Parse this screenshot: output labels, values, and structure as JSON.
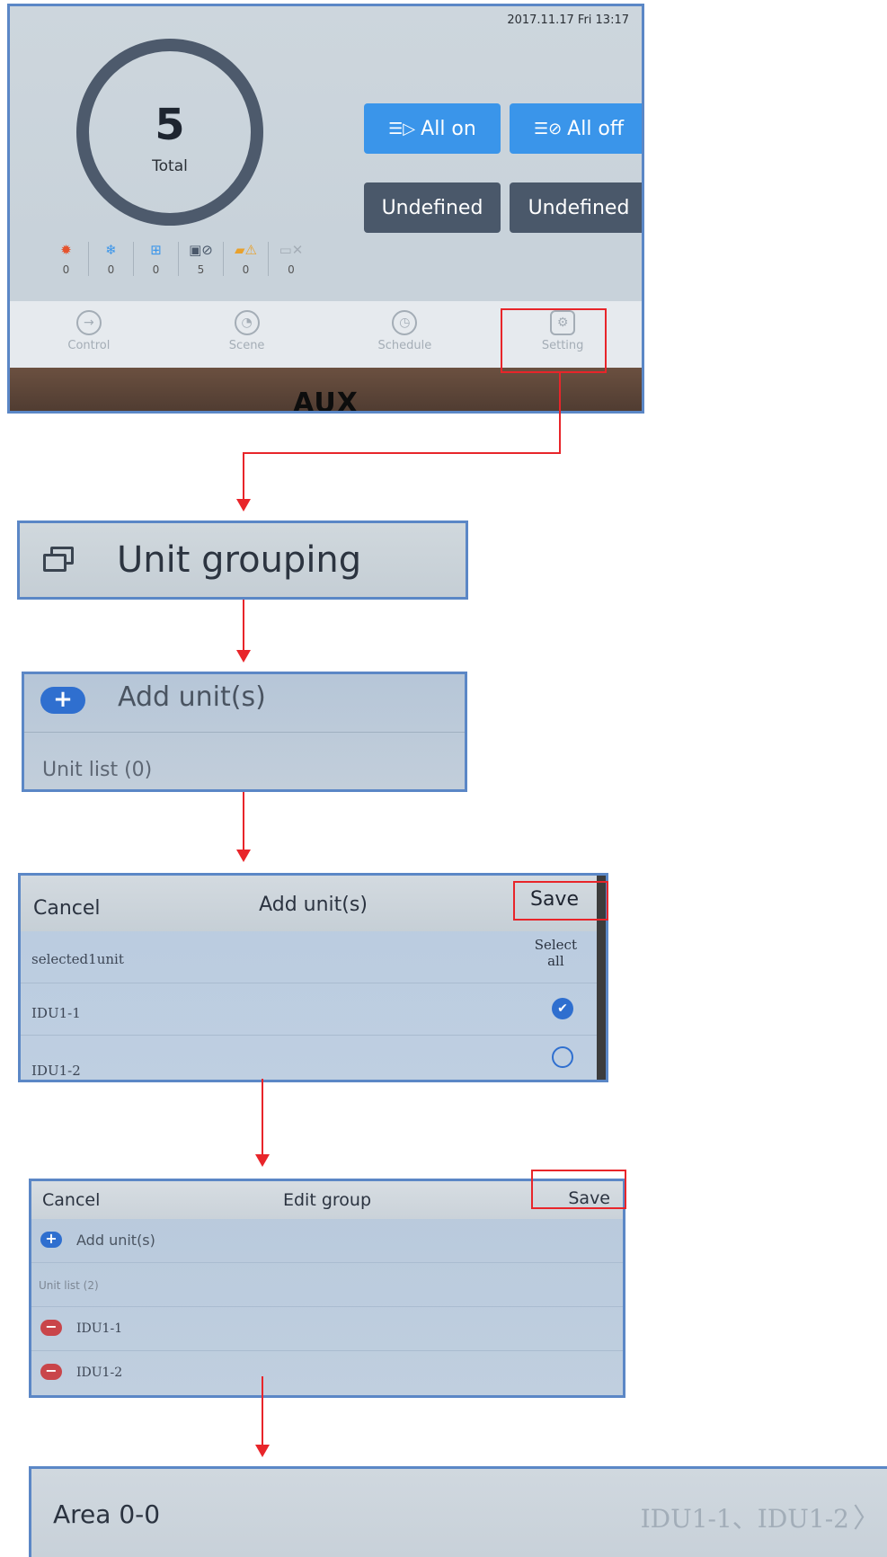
{
  "home": {
    "datetime": "2017.11.17 Fri 13:17",
    "total_count": "5",
    "total_label": "Total",
    "all_on_label": "All on",
    "all_off_label": "All off",
    "undefined_1_label": "Undefined",
    "undefined_2_label": "Undefined",
    "stats": [
      {
        "icon": "heat-icon",
        "value": "0"
      },
      {
        "icon": "cool-icon",
        "value": "0"
      },
      {
        "icon": "mode-grid-icon",
        "value": "0"
      },
      {
        "icon": "unit-off-icon",
        "value": "5"
      },
      {
        "icon": "warning-icon",
        "value": "0"
      },
      {
        "icon": "disconnected-icon",
        "value": "0"
      }
    ],
    "nav": [
      {
        "label": "Control",
        "icon": "control-icon"
      },
      {
        "label": "Scene",
        "icon": "scene-icon"
      },
      {
        "label": "Schedule",
        "icon": "schedule-icon"
      },
      {
        "label": "Setting",
        "icon": "gear-icon"
      }
    ],
    "brand": "AUX"
  },
  "grouping": {
    "title": "Unit grouping"
  },
  "units_panel": {
    "add_label": "Add unit(s)",
    "list_label": "Unit list (0)"
  },
  "add_dialog": {
    "cancel": "Cancel",
    "title": "Add unit(s)",
    "save": "Save",
    "select_all_line1": "Select",
    "select_all_line2": "all",
    "selected_text": "selected1unit",
    "items": [
      {
        "name": "IDU1-1",
        "checked": true
      },
      {
        "name": "IDU1-2",
        "checked": false
      }
    ]
  },
  "edit_group": {
    "cancel": "Cancel",
    "title": "Edit group",
    "save": "Save",
    "add_label": "Add unit(s)",
    "list_label": "Unit list (2)",
    "items": [
      "IDU1-1",
      "IDU1-2"
    ]
  },
  "area_row": {
    "area": "Area 0-0",
    "units": "IDU1-1、IDU1-2"
  },
  "colors": {
    "accent_blue": "#3a95ea",
    "dark_button": "#4a586a",
    "highlight_red": "#e8252a",
    "remove_red": "#c9454a"
  }
}
